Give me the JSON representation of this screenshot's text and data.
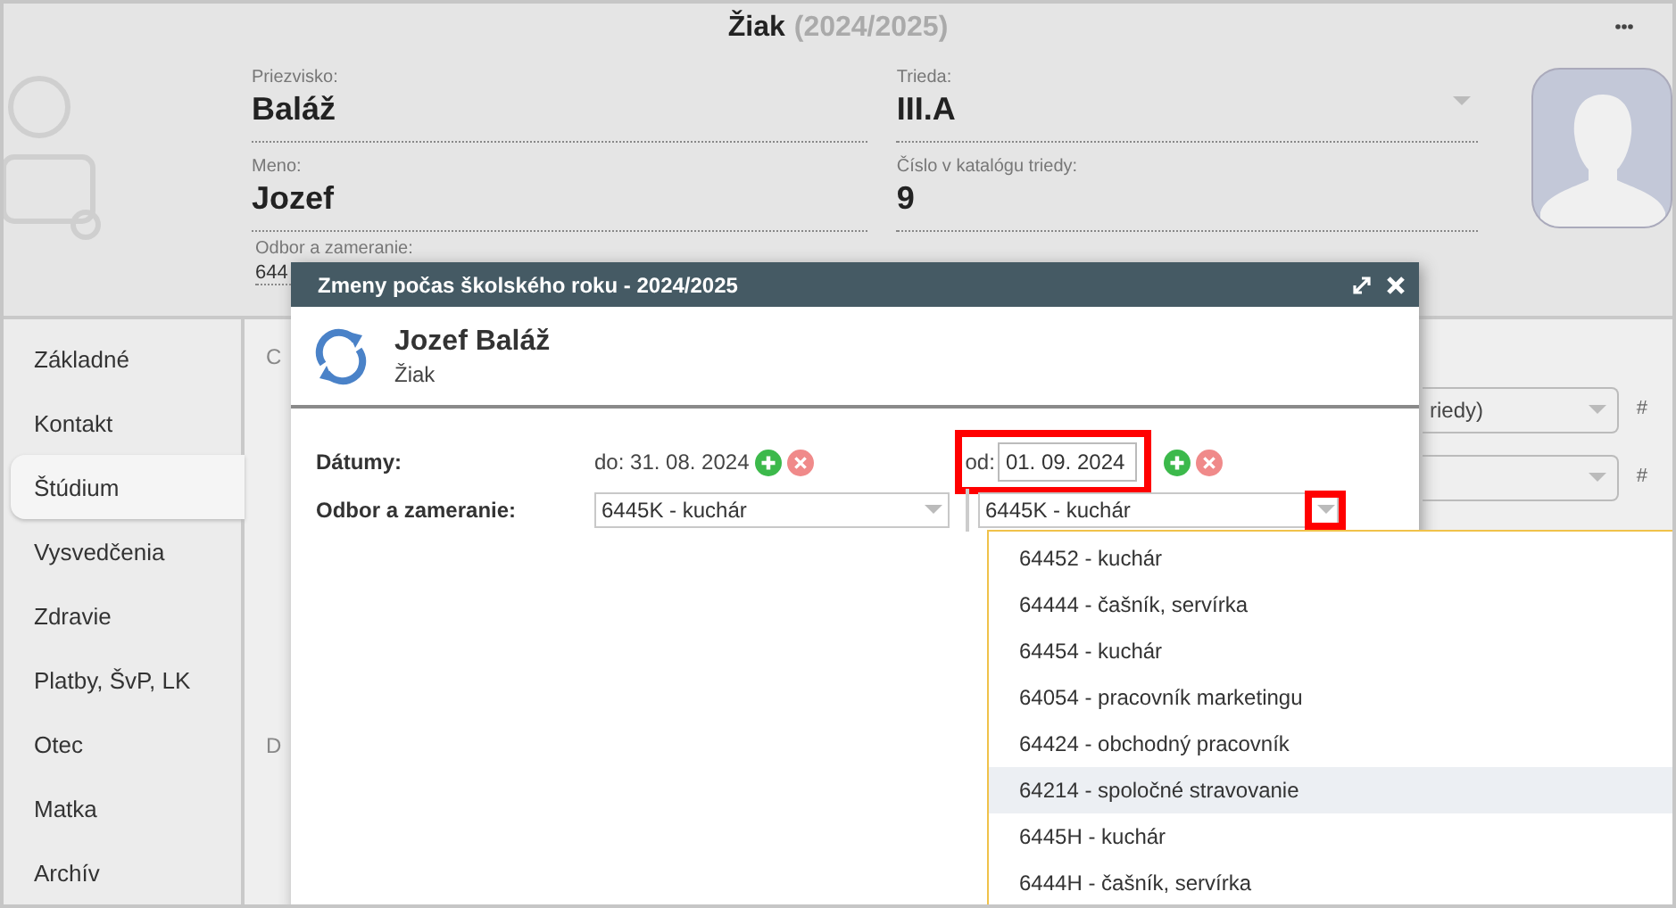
{
  "header": {
    "title": "Žiak",
    "year": "(2024/2025)"
  },
  "profile": {
    "left": [
      {
        "label": "Priezvisko:",
        "value": "Baláž"
      },
      {
        "label": "Meno:",
        "value": "Jozef"
      }
    ],
    "right": [
      {
        "label": "Trieda:",
        "value": "III.A",
        "kind": "select"
      },
      {
        "label": "Číslo v katalógu triedy:",
        "value": "9",
        "kind": "text"
      }
    ],
    "study": {
      "label": "Odbor a zameranie:",
      "value": "644"
    }
  },
  "sidebar": {
    "items": [
      {
        "label": "Základné",
        "selected": false
      },
      {
        "label": "Kontakt",
        "selected": false
      },
      {
        "label": "Štúdium",
        "selected": true
      },
      {
        "label": "Vysvedčenia",
        "selected": false
      },
      {
        "label": "Zdravie",
        "selected": false
      },
      {
        "label": "Platby, ŠvP, LK",
        "selected": false
      },
      {
        "label": "Otec",
        "selected": false
      },
      {
        "label": "Matka",
        "selected": false
      },
      {
        "label": "Archív",
        "selected": false
      }
    ]
  },
  "content": {
    "sections": [
      "C",
      "D"
    ],
    "selects": [
      {
        "value": "riedy)",
        "suffix": "#"
      },
      {
        "suffix": "#"
      }
    ]
  },
  "modal": {
    "title": "Zmeny počas školského roku - 2024/2025",
    "person": "Jozef Baláž",
    "role": "Žiak",
    "dates": {
      "label": "Dátumy:",
      "to": "do: 31. 08. 2024",
      "from_label": "od:",
      "from_value": "01. 09. 2024",
      "highlighted": true
    },
    "study": {
      "label": "Odbor a zameranie:",
      "old_value": "6445K - kuchár",
      "new_value": "6445K - kuchár",
      "arrow_highlighted": true
    },
    "options": [
      {
        "label": "64452 - kuchár",
        "selected": false
      },
      {
        "label": "64444 - čašník, servírka",
        "selected": false
      },
      {
        "label": "64454 - kuchár",
        "selected": false
      },
      {
        "label": "64054 - pracovník marketingu",
        "selected": false
      },
      {
        "label": "64424 - obchodný pracovník",
        "selected": false
      },
      {
        "label": "64214 - spoločné stravovanie",
        "selected": true
      },
      {
        "label": "6445H - kuchár",
        "selected": false
      },
      {
        "label": "6444H - čašník, servírka",
        "selected": false
      }
    ]
  }
}
